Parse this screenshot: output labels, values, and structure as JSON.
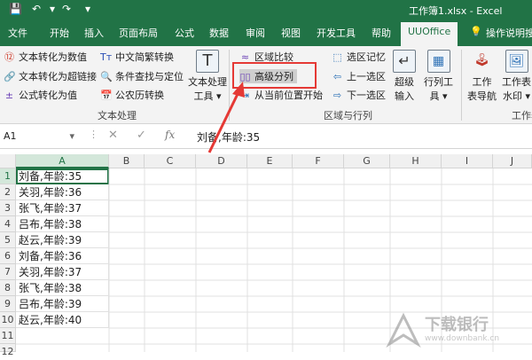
{
  "titlebar": {
    "title": "工作簿1.xlsx  -  Excel"
  },
  "tabs": [
    {
      "label": "文件"
    },
    {
      "label": "开始"
    },
    {
      "label": "插入"
    },
    {
      "label": "页面布局"
    },
    {
      "label": "公式"
    },
    {
      "label": "数据"
    },
    {
      "label": "审阅"
    },
    {
      "label": "视图"
    },
    {
      "label": "开发工具"
    },
    {
      "label": "帮助"
    },
    {
      "label": "UUOffice"
    },
    {
      "label": "操作说明搜"
    }
  ],
  "ribbon": {
    "text_group": {
      "items": [
        {
          "label": "文本转化为数值"
        },
        {
          "label": "文本转化为超链接"
        },
        {
          "label": "公式转化为值"
        },
        {
          "label": "中文简繁转换"
        },
        {
          "label": "条件查找与定位"
        },
        {
          "label": "公农历转换"
        }
      ],
      "big_button": "文本处理\n工具",
      "big_button_l1": "文本处理",
      "big_button_l2": "工具 ▾",
      "label": "文本处理"
    },
    "region_group": {
      "items": [
        {
          "label": "区域比较"
        },
        {
          "label": "高级分列"
        },
        {
          "label": "从当前位置开始"
        },
        {
          "label": "选区记忆"
        },
        {
          "label": "上一选区"
        },
        {
          "label": "下一选区"
        }
      ],
      "big1_l1": "超级",
      "big1_l2": "输入",
      "big2_l1": "行列工",
      "big2_l2": "具 ▾",
      "label": "区域与行列"
    },
    "work_group": {
      "big1_l1": "工作",
      "big1_l2": "表导航",
      "big2_l1": "工作表",
      "big2_l2": "水印 ▾",
      "label": "工作表"
    }
  },
  "formula_bar": {
    "name_box": "A1",
    "value": "刘备,年龄:35"
  },
  "grid": {
    "columns": [
      "A",
      "B",
      "C",
      "D",
      "E",
      "F",
      "G",
      "H",
      "I",
      "J"
    ],
    "rows": [
      "1",
      "2",
      "3",
      "4",
      "5",
      "6",
      "7",
      "8",
      "9",
      "10",
      "11",
      "12"
    ],
    "column_a": [
      "刘备,年龄:35",
      "关羽,年龄:36",
      "张飞,年龄:37",
      "吕布,年龄:38",
      "赵云,年龄:39",
      "刘备,年龄:36",
      "关羽,年龄:37",
      "张飞,年龄:38",
      "吕布,年龄:39",
      "赵云,年龄:40"
    ]
  },
  "watermark": {
    "text": "下载银行",
    "url": "www.downbank.cn"
  },
  "colors": {
    "excel_green": "#217346",
    "annotation_red": "#e53935"
  }
}
